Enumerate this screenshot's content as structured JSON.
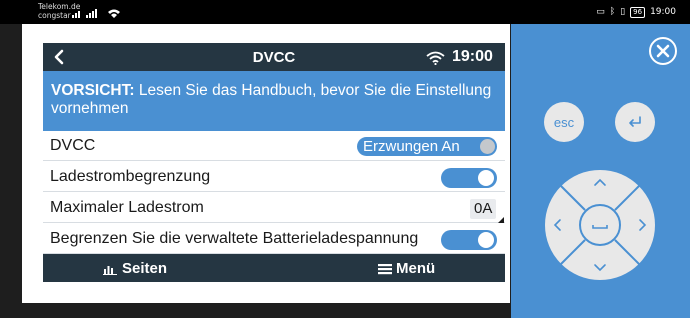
{
  "statusbar": {
    "carrier_line1": "Telekom.de",
    "carrier_line2": "congstar",
    "battery": "96",
    "time": "19:00"
  },
  "panel": {
    "title": "DVCC",
    "time": "19:00",
    "warning_bold": "VORSICHT:",
    "warning_text": " Lesen Sie das Handbuch, bevor Sie die Einstellung vornehmen",
    "rows": [
      {
        "label": "DVCC",
        "value": "Erzwungen An"
      },
      {
        "label": "Ladestrombegrenzung",
        "switch_on": true
      },
      {
        "label": "Maximaler Ladestrom",
        "value": "0A"
      },
      {
        "label": "Begrenzen Sie die verwaltete Batterieladespannung",
        "switch_on": true
      }
    ],
    "footer_left": "Seiten",
    "footer_right": "Menü"
  },
  "remote": {
    "esc_label": "esc"
  },
  "colors": {
    "header": "#253642",
    "accent": "#4a90d2",
    "remote_bg": "#4a90d2"
  }
}
